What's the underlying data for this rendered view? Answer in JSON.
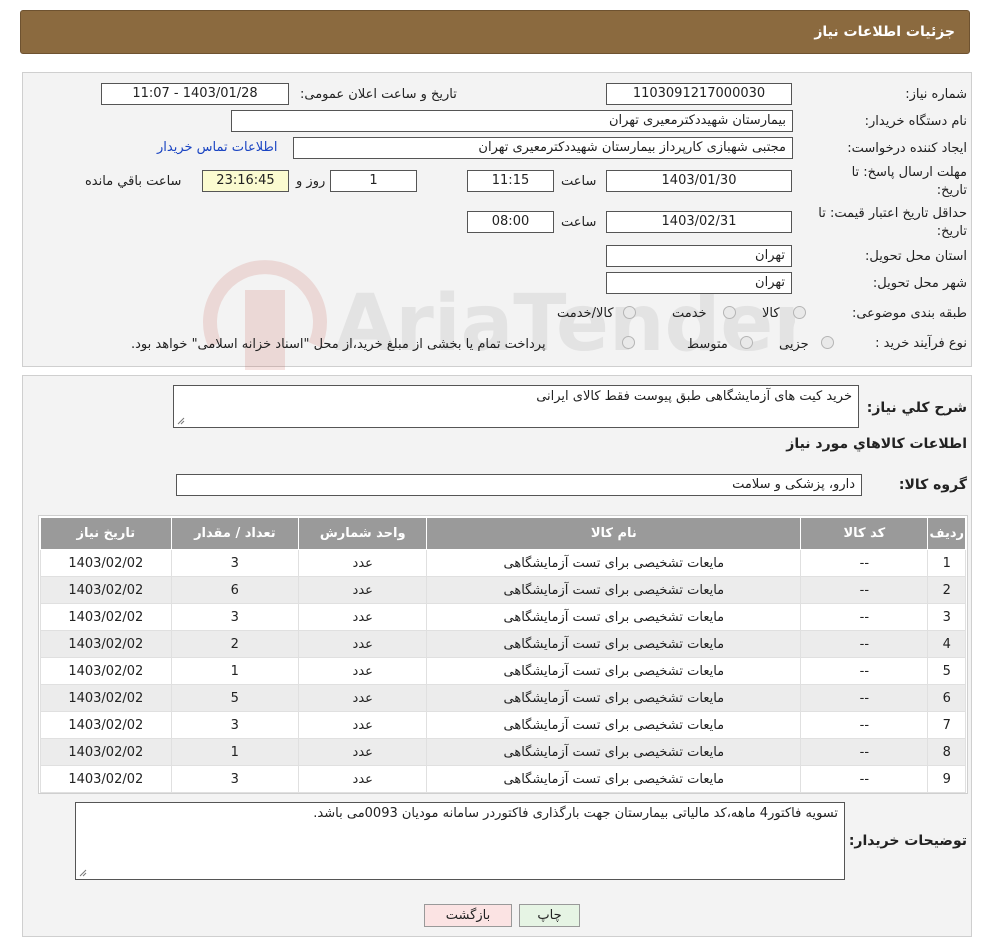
{
  "header": {
    "title": "جزئیات اطلاعات نیاز"
  },
  "form": {
    "need_number_label": "شماره نیاز:",
    "need_number": "1103091217000030",
    "announce_label": "تاریخ و ساعت اعلان عمومی:",
    "announce_value": "1403/01/28 - 11:07",
    "buyer_org_label": "نام دستگاه خریدار:",
    "buyer_org": "بیمارستان شهیددکترمعیری تهران",
    "creator_label": "ایجاد کننده درخواست:",
    "creator": "مجتبی  شهبازی کارپرداز بیمارستان شهیددکترمعیری تهران",
    "contact_link": "اطلاعات تماس خریدار",
    "deadline_label_1": "مهلت ارسال پاسخ: تا",
    "deadline_label_2": "تاریخ:",
    "deadline_date": "1403/01/30",
    "time_label": "ساعت",
    "deadline_time": "11:15",
    "days_value": "1",
    "days_label": "روز و",
    "remaining_value": "23:16:45",
    "remaining_label": "ساعت باقي مانده",
    "validity_label_1": "حداقل تاریخ اعتبار قیمت: تا",
    "validity_label_2": "تاریخ:",
    "validity_date": "1403/02/31",
    "validity_time_label": "ساعت",
    "validity_time": "08:00",
    "province_label": "استان محل تحویل:",
    "province": "تهران",
    "city_label": "شهر محل تحویل:",
    "city": "تهران",
    "category_label": "طبقه بندی موضوعی:",
    "category_options": [
      "کالا",
      "خدمت",
      "کالا/خدمت"
    ],
    "process_label": "نوع فرآیند خرید :",
    "process_options": [
      "جزیی",
      "متوسط"
    ],
    "process_note": "پرداخت تمام یا بخشی از مبلغ خرید،از محل \"اسناد خزانه اسلامی\" خواهد بود."
  },
  "summary": {
    "desc_label": "شرح کلي نياز:",
    "desc": "خرید کیت های آزمایشگاهی طبق پیوست فقط کالای ایرانی",
    "goods_info_title": "اطلاعات کالاهاي مورد نياز",
    "group_label": "گروه کالا:",
    "group": "دارو، پزشکی و سلامت"
  },
  "table": {
    "headers": [
      "رديف",
      "کد کالا",
      "نام کالا",
      "واحد شمارش",
      "تعداد / مقدار",
      "تاریخ نیاز"
    ],
    "rows": [
      [
        "1",
        "--",
        "مایعات تشخیصی برای تست آزمایشگاهی",
        "عدد",
        "3",
        "1403/02/02"
      ],
      [
        "2",
        "--",
        "مایعات تشخیصی برای تست آزمایشگاهی",
        "عدد",
        "6",
        "1403/02/02"
      ],
      [
        "3",
        "--",
        "مایعات تشخیصی برای تست آزمایشگاهی",
        "عدد",
        "3",
        "1403/02/02"
      ],
      [
        "4",
        "--",
        "مایعات تشخیصی برای تست آزمایشگاهی",
        "عدد",
        "2",
        "1403/02/02"
      ],
      [
        "5",
        "--",
        "مایعات تشخیصی برای تست آزمایشگاهی",
        "عدد",
        "1",
        "1403/02/02"
      ],
      [
        "6",
        "--",
        "مایعات تشخیصی برای تست آزمایشگاهی",
        "عدد",
        "5",
        "1403/02/02"
      ],
      [
        "7",
        "--",
        "مایعات تشخیصی برای تست آزمایشگاهی",
        "عدد",
        "3",
        "1403/02/02"
      ],
      [
        "8",
        "--",
        "مایعات تشخیصی برای تست آزمایشگاهی",
        "عدد",
        "1",
        "1403/02/02"
      ],
      [
        "9",
        "--",
        "مایعات تشخیصی برای تست آزمایشگاهی",
        "عدد",
        "3",
        "1403/02/02"
      ]
    ]
  },
  "notes": {
    "label": "توضیحات خریدار:",
    "text": "تسویه فاکتور4 ماهه،کد مالیاتی بیمارستان جهت بارگذاری فاکتوردر سامانه مودیان 0093می باشد."
  },
  "buttons": {
    "print": "چاپ",
    "back": "بازگشت"
  },
  "watermark": {
    "text": "AriaTender.neT"
  }
}
